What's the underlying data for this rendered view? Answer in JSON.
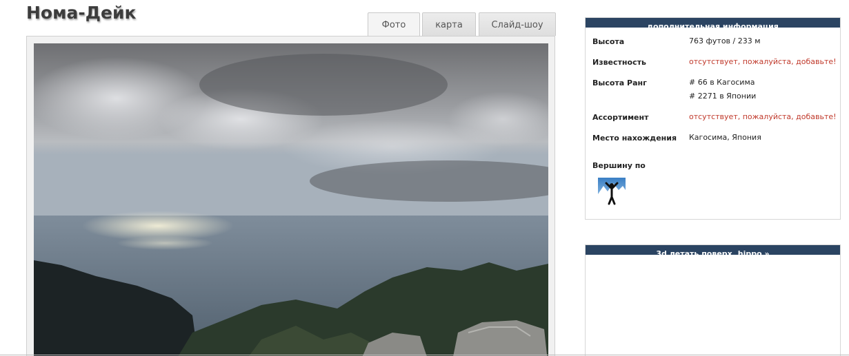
{
  "page": {
    "title": "Нома-Дейк"
  },
  "tabs": [
    {
      "label": "Фото",
      "active": true
    },
    {
      "label": "карта",
      "active": false
    },
    {
      "label": "Слайд-шоу",
      "active": false
    }
  ],
  "info": {
    "header": "дополнительная информация",
    "rows": [
      {
        "label": "Высота",
        "value": "763 футов / 233 м",
        "missing": false
      },
      {
        "label": "Известность",
        "value": "отсутствует, пожалуйста, добавьте!",
        "missing": true
      },
      {
        "label": "Высота Ранг",
        "value": "# 66 в Кагосима",
        "value2": "# 2271 в Японии",
        "missing": false
      },
      {
        "label": "Ассортимент",
        "value": "отсутствует, пожалуйста, добавьте!",
        "missing": true
      },
      {
        "label": "Место нахождения",
        "value": "Кагосима, Япония",
        "missing": false
      }
    ],
    "summit_label": "Вершину по"
  },
  "widget": {
    "header": "3d летать поверх. hippo »"
  },
  "colors": {
    "header_bg": "#2b4462",
    "missing_text": "#c0392b"
  }
}
